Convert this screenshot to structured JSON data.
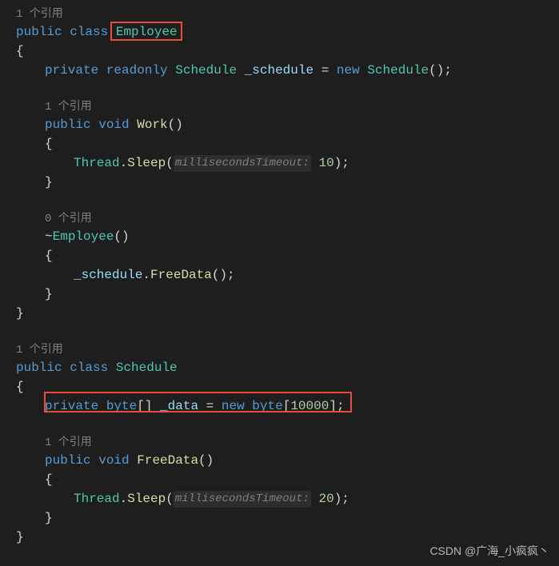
{
  "ref": {
    "one": "1 个引用",
    "zero": "0 个引用"
  },
  "kw": {
    "public": "public",
    "class": "class",
    "private": "private",
    "readonly": "readonly",
    "void": "void",
    "new": "new",
    "byte": "byte"
  },
  "types": {
    "employee": "Employee",
    "schedule": "Schedule",
    "thread": "Thread"
  },
  "methods": {
    "work": "Work",
    "sleep": "Sleep",
    "freeData": "FreeData"
  },
  "fields": {
    "schedule": "_schedule",
    "data": "_data"
  },
  "params": {
    "msTimeout": "millisecondsTimeout:"
  },
  "numbers": {
    "ten": "10",
    "twenty": "20",
    "arraySize": "10000"
  },
  "punct": {
    "openBrace": "{",
    "closeBrace": "}",
    "openParen": "(",
    "closeParen": ")",
    "semi": ";",
    "dot": ".",
    "eq": " = ",
    "brackets": "[]",
    "openBracket": "[",
    "closeBracket": "]",
    "tilde": "~"
  },
  "watermark": "CSDN @广海_小疯疯丶"
}
